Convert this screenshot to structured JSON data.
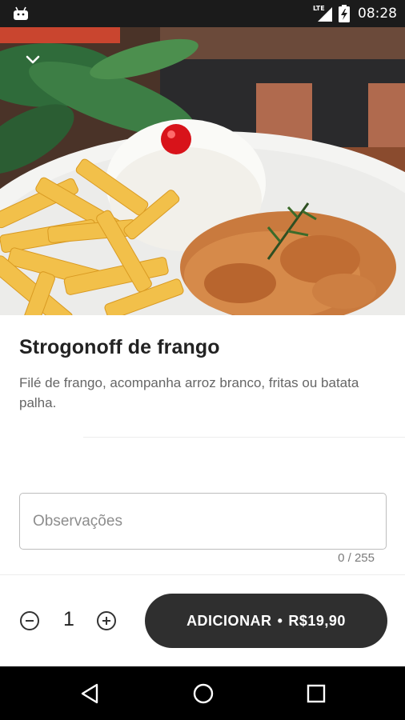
{
  "status_bar": {
    "network_label": "LTE",
    "time": "08:28",
    "icons": [
      "android-debug-icon",
      "signal-icon",
      "battery-charging-icon"
    ]
  },
  "hero": {
    "image": "food-photo-strogonoff-rice-fries",
    "back_icon": "chevron-down-icon"
  },
  "product": {
    "name": "Strogonoff de frango",
    "description": "Filé de frango,  acompanha arroz branco, fritas ou batata palha."
  },
  "notes": {
    "placeholder": "Observações",
    "value": "",
    "counter": "0 / 255"
  },
  "order": {
    "quantity": "1",
    "minus_icon": "minus-circle-icon",
    "plus_icon": "plus-circle-icon",
    "add_label": "ADICIONAR",
    "separator": "•",
    "price": "R$19,90"
  },
  "nav_bar": {
    "back_icon": "nav-back-icon",
    "home_icon": "nav-home-icon",
    "recents_icon": "nav-recents-icon"
  },
  "colors": {
    "button_bg": "#2f2f2f",
    "status_bar_bg": "#1b1b1b",
    "nav_bar_bg": "#000000",
    "description_text": "#666666"
  }
}
